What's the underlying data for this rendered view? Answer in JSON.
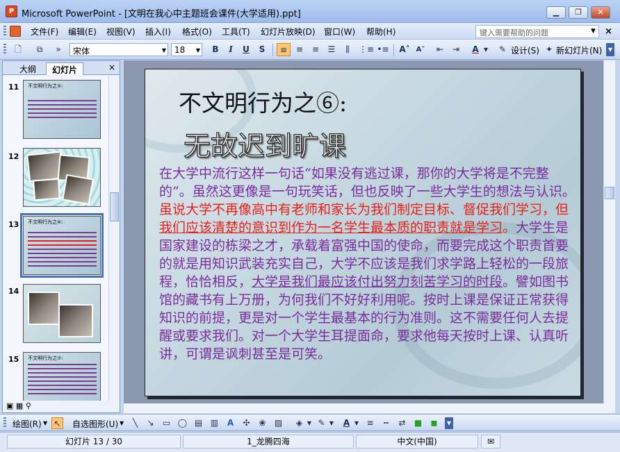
{
  "window": {
    "title": "Microsoft PowerPoint - [文明在我心中主题班会课件(大学适用).ppt]",
    "app_icon": "powerpoint-icon",
    "controls": [
      "minimize-icon",
      "restore-icon",
      "close-icon"
    ]
  },
  "menu": {
    "items": [
      "文件(F)",
      "编辑(E)",
      "视图(V)",
      "插入(I)",
      "格式(O)",
      "工具(T)",
      "幻灯片放映(D)",
      "窗口(W)",
      "帮助(H)"
    ],
    "help_placeholder": "键入需要帮助的问题"
  },
  "toolbar": {
    "font": "宋体",
    "size": "18",
    "bold": "B",
    "italic": "I",
    "underline": "U",
    "shadow": "S",
    "design": "设计(S)",
    "new_slide": "新幻灯片(N)"
  },
  "leftpane": {
    "tabs": [
      "大纲",
      "幻灯片"
    ],
    "close": "×",
    "thumbnails": [
      {
        "num": "11",
        "title": "不文明行为之⑤:"
      },
      {
        "num": "12",
        "title": ""
      },
      {
        "num": "13",
        "title": "不文明行为之⑥:"
      },
      {
        "num": "14",
        "title": ""
      },
      {
        "num": "15",
        "title": "不文明行为之⑦:"
      }
    ],
    "selected": "13"
  },
  "slide": {
    "title": "不文明行为之⑥:",
    "subtitle": "无故迟到旷课",
    "body_1": "在大学中流行这样一句话“如果没有逃过课，那你的大学将是不完整的”。虽然这更像是一句玩笑话，但也反映了一些大学生的想法与认识。",
    "body_red_1": "虽说大学不再像高中有老师和家长为我们制定目标、督促我们学习，但",
    "body_red_underline": "我们应该清楚的意识到作为一名学生最本质的职责就是学习",
    "body_red_2": "。",
    "body_2": "大学生是国家建设的栋梁之才，承载着富强中国的使命，而要完成这个职责首要的就是用知识武装充实自己，大学不应该是我们求学路上轻松的一段旅程，恰恰相反，",
    "body_underline": "大学是我们最应该付出努力刻苦学习的时段",
    "body_3": "。譬如图书馆的藏书有上万册，为何我们不好好利用呢。按时上课是保证正常获得知识的前提，更是对一个学生最基本的行为准则。这不需要任何人去提醒或要求我们。对一个大学生耳提面命，要求他每天按时上课、认真听讲，可谓是讽刺甚至是可笑。"
  },
  "drawbar": {
    "draw": "绘图(R)",
    "autoshapes": "自选图形(U)"
  },
  "status": {
    "slide": "幻灯片 13 / 30",
    "design": "1_龙腾四海",
    "language": "中文(中国)"
  }
}
